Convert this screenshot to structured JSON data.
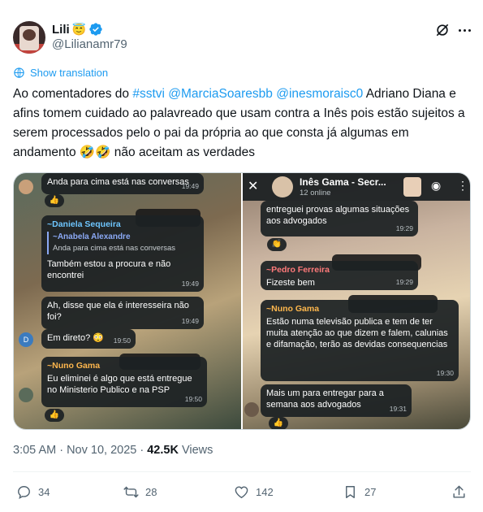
{
  "user": {
    "display_name": "Lili",
    "halo_emoji": "😇",
    "handle": "@Lilianamr79"
  },
  "translate_label": "Show translation",
  "tweet": {
    "part1": "Ao comentadores do ",
    "tag1": "#sstvi",
    "sp1": " ",
    "mention1": "@MarciaSoaresbb",
    "sp2": " ",
    "mention2": "@inesmoraisc0",
    "part2": " Adriano Diana e afins tomem cuidado ao palavreado que usam contra a Inês pois estão sujeitos a serem processados pelo o pai da própria ao que consta já algumas em andamento 🤣🤣 não aceitam as verdades"
  },
  "left_chat": {
    "m1_text": "Anda para cima está nas conversas",
    "m1_time": "19:49",
    "m1_react": "👍",
    "m2_sender": "~Daniela Sequeira",
    "m2_quote_name": "~Anabela Alexandre",
    "m2_quote_text": "Anda para cima está nas conversas",
    "m2_text": "Também estou a procura e não encontrei",
    "m2_time": "19:49",
    "m3_text": "Ah, disse que ela é interesseira não foi?",
    "m3_time": "19:49",
    "m4_avatar": "D",
    "m4_text": "Em direto? 😳",
    "m4_time": "19:50",
    "m5_sender": "~Nuno Gama",
    "m5_text": "Eu eliminei é algo que está entregue no Ministerio Publico e na PSP",
    "m5_time": "19:50",
    "m5_react": "👍"
  },
  "right_chat": {
    "back": "✕",
    "title": "Inês Gama - Secr...",
    "subtitle": "12 online",
    "m1_text": "entreguei provas algumas situações aos advogados",
    "m1_time": "19:29",
    "m1_react": "👏",
    "m2_sender": "~Pedro Ferreira",
    "m2_text": "Fizeste bem",
    "m2_time": "19:29",
    "m3_sender": "~Nuno Gama",
    "m3_text": "Estão numa televisão publica e tem de ter muita atenção ao que dizem e falem, calunias e difamação, terão as devidas consequencias",
    "m3_time": "19:30",
    "m4_text": "Mais um para entregar para a semana aos advogados",
    "m4_time": "19:31",
    "m4_react": "👍"
  },
  "meta": {
    "time_date": "3:05 AM · Nov 10, 2025 · ",
    "views_count": "42.5K",
    "views_label": " Views"
  },
  "actions": {
    "replies": "34",
    "reposts": "28",
    "likes": "142",
    "bookmarks": "27"
  },
  "colors": {
    "link": "#1d9bf0",
    "verified": "#1d9bf0",
    "secondary_text": "#536471"
  }
}
